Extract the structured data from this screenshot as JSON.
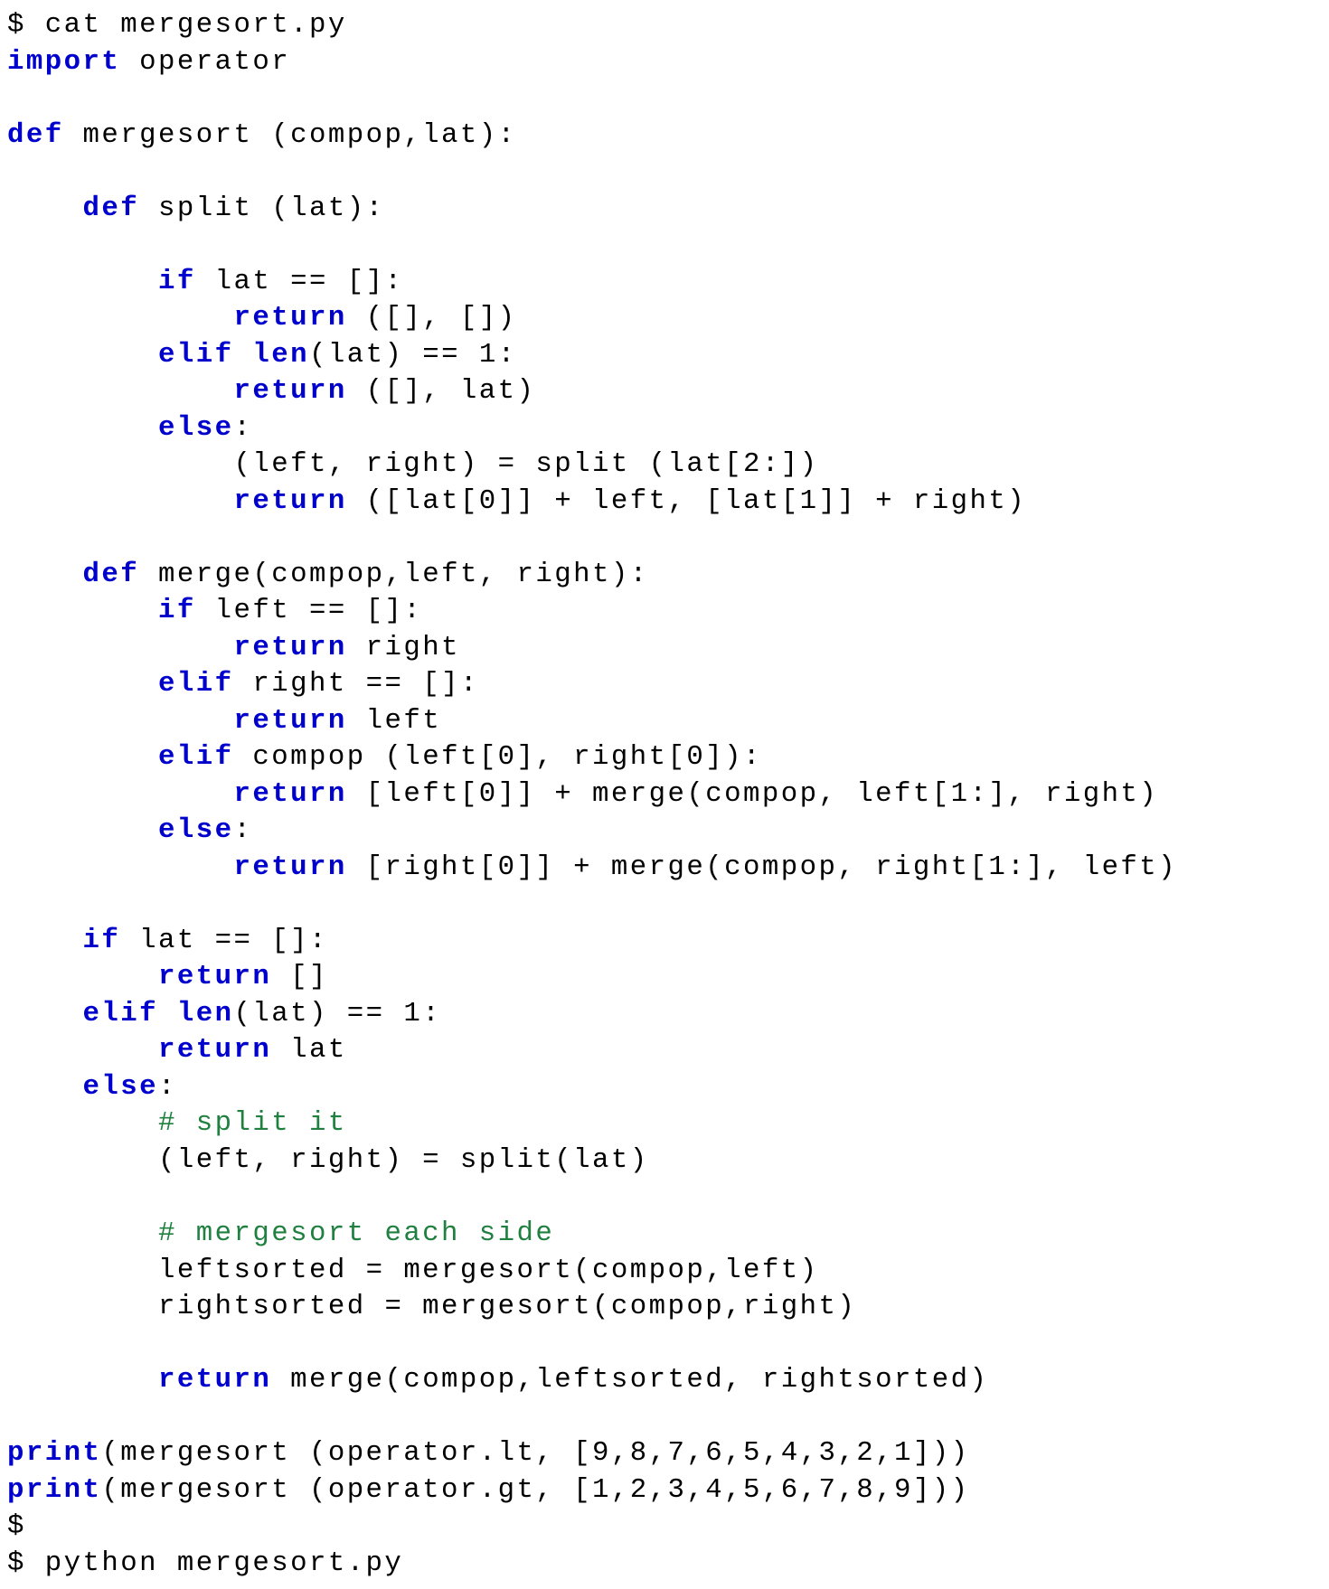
{
  "terminal": {
    "prompts": {
      "p1_dollar": "$",
      "cat_cmd": " cat mergesort.py",
      "p2_dollar": "$",
      "p3_dollar": "$",
      "run_cmd": " python mergesort.py"
    },
    "code": {
      "l01_import": "import",
      "l01_rest": " operator",
      "l03_def": "def",
      "l03_rest": " mergesort (compop,lat):",
      "l05_pad": "    ",
      "l05_def": "def",
      "l05_rest": " split (lat):",
      "l07_pad": "        ",
      "l07_if": "if",
      "l07_rest": " lat == []:",
      "l08_pad": "            ",
      "l08_ret": "return",
      "l08_rest": " ([], [])",
      "l09_pad": "        ",
      "l09_elif": "elif",
      "l09_sp": " ",
      "l09_len": "len",
      "l09_rest": "(lat) == 1:",
      "l10_pad": "            ",
      "l10_ret": "return",
      "l10_rest": " ([], lat)",
      "l11_pad": "        ",
      "l11_else": "else",
      "l11_rest": ":",
      "l12_pad": "            ",
      "l12_rest": "(left, right) = split (lat[2:])",
      "l13_pad": "            ",
      "l13_ret": "return",
      "l13_rest": " ([lat[0]] + left, [lat[1]] + right)",
      "l15_pad": "    ",
      "l15_def": "def",
      "l15_rest": " merge(compop,left, right):",
      "l16_pad": "        ",
      "l16_if": "if",
      "l16_rest": " left == []:",
      "l17_pad": "            ",
      "l17_ret": "return",
      "l17_rest": " right",
      "l18_pad": "        ",
      "l18_elif": "elif",
      "l18_rest": " right == []:",
      "l19_pad": "            ",
      "l19_ret": "return",
      "l19_rest": " left",
      "l20_pad": "        ",
      "l20_elif": "elif",
      "l20_rest": " compop (left[0], right[0]):",
      "l21_pad": "            ",
      "l21_ret": "return",
      "l21_rest": " [left[0]] + merge(compop, left[1:], right)",
      "l22_pad": "        ",
      "l22_else": "else",
      "l22_rest": ":",
      "l23_pad": "            ",
      "l23_ret": "return",
      "l23_rest": " [right[0]] + merge(compop, right[1:], left)",
      "l25_pad": "    ",
      "l25_if": "if",
      "l25_rest": " lat == []:",
      "l26_pad": "        ",
      "l26_ret": "return",
      "l26_rest": " []",
      "l27_pad": "    ",
      "l27_elif": "elif",
      "l27_sp": " ",
      "l27_len": "len",
      "l27_rest": "(lat) == 1:",
      "l28_pad": "        ",
      "l28_ret": "return",
      "l28_rest": " lat",
      "l29_pad": "    ",
      "l29_else": "else",
      "l29_rest": ":",
      "l30_pad": "        ",
      "l30_cmt": "# split it",
      "l31_pad": "        ",
      "l31_rest": "(left, right) = split(lat)",
      "l33_pad": "        ",
      "l33_cmt": "# mergesort each side",
      "l34_pad": "        ",
      "l34_rest": "leftsorted = mergesort(compop,left)",
      "l35_pad": "        ",
      "l35_rest": "rightsorted = mergesort(compop,right)",
      "l37_pad": "        ",
      "l37_ret": "return",
      "l37_rest": " merge(compop,leftsorted, rightsorted)",
      "l39_print": "print",
      "l39_rest": "(mergesort (operator.lt, [9,8,7,6,5,4,3,2,1]))",
      "l40_print": "print",
      "l40_rest": "(mergesort (operator.gt, [1,2,3,4,5,6,7,8,9]))"
    }
  }
}
